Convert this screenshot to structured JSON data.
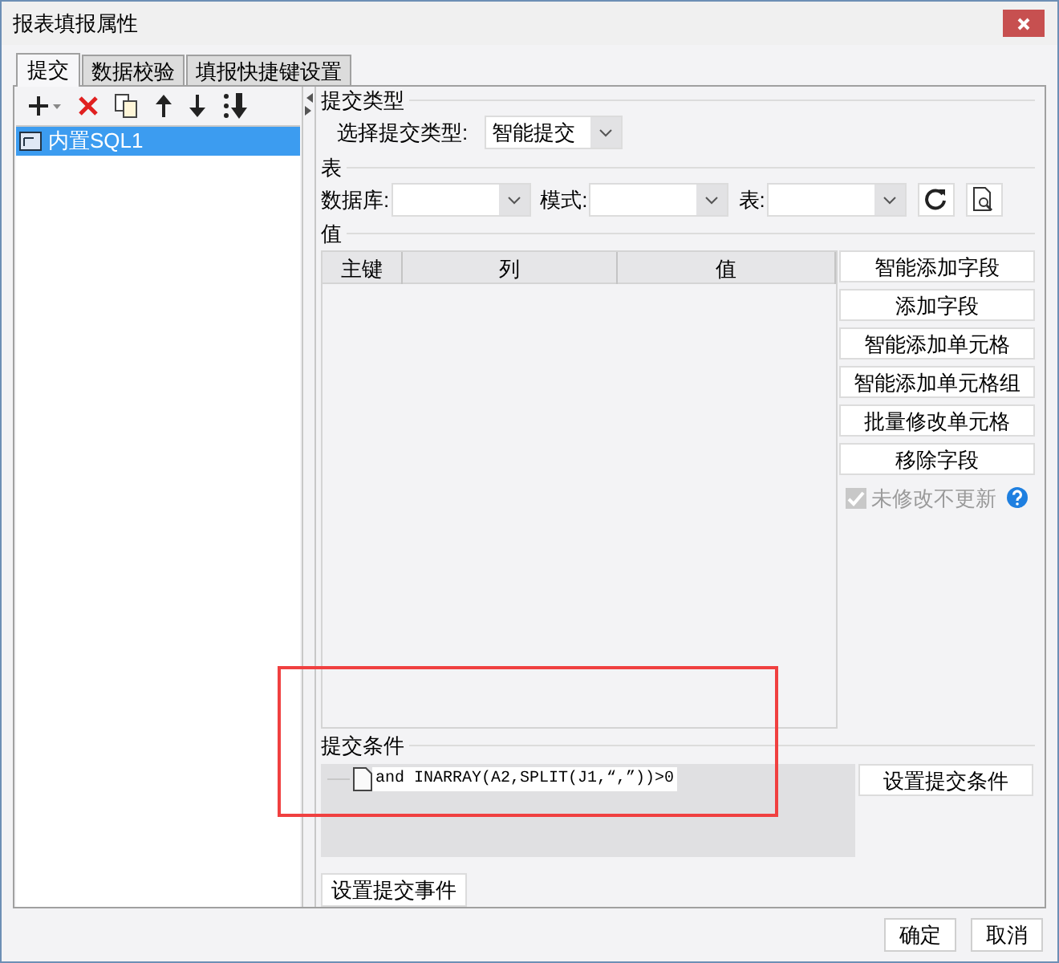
{
  "window": {
    "title": "报表填报属性"
  },
  "tabs": [
    {
      "label": "提交",
      "selected": true
    },
    {
      "label": "数据校验",
      "selected": false
    },
    {
      "label": "填报快捷键设置",
      "selected": false
    }
  ],
  "list": [
    {
      "label": "内置SQL1",
      "selected": true
    }
  ],
  "submit_type": {
    "title": "提交类型",
    "label": "选择提交类型:",
    "value": "智能提交"
  },
  "table_section": {
    "title": "表",
    "database_label": "数据库:",
    "schema_label": "模式:",
    "table_label": "表:"
  },
  "values": {
    "title": "值",
    "columns": [
      "主键",
      "列",
      "值"
    ],
    "buttons": [
      "智能添加字段",
      "添加字段",
      "智能添加单元格",
      "智能添加单元格组",
      "批量修改单元格",
      "移除字段"
    ],
    "checkbox": {
      "label": "未修改不更新",
      "checked": true,
      "disabled": true
    }
  },
  "condition": {
    "title": "提交条件",
    "items": [
      {
        "text": "and INARRAY(A2,SPLIT(J1,“,”))>0"
      }
    ],
    "button": "设置提交条件"
  },
  "event_button": "设置提交事件",
  "footer_buttons": [
    "确定",
    "取消"
  ]
}
